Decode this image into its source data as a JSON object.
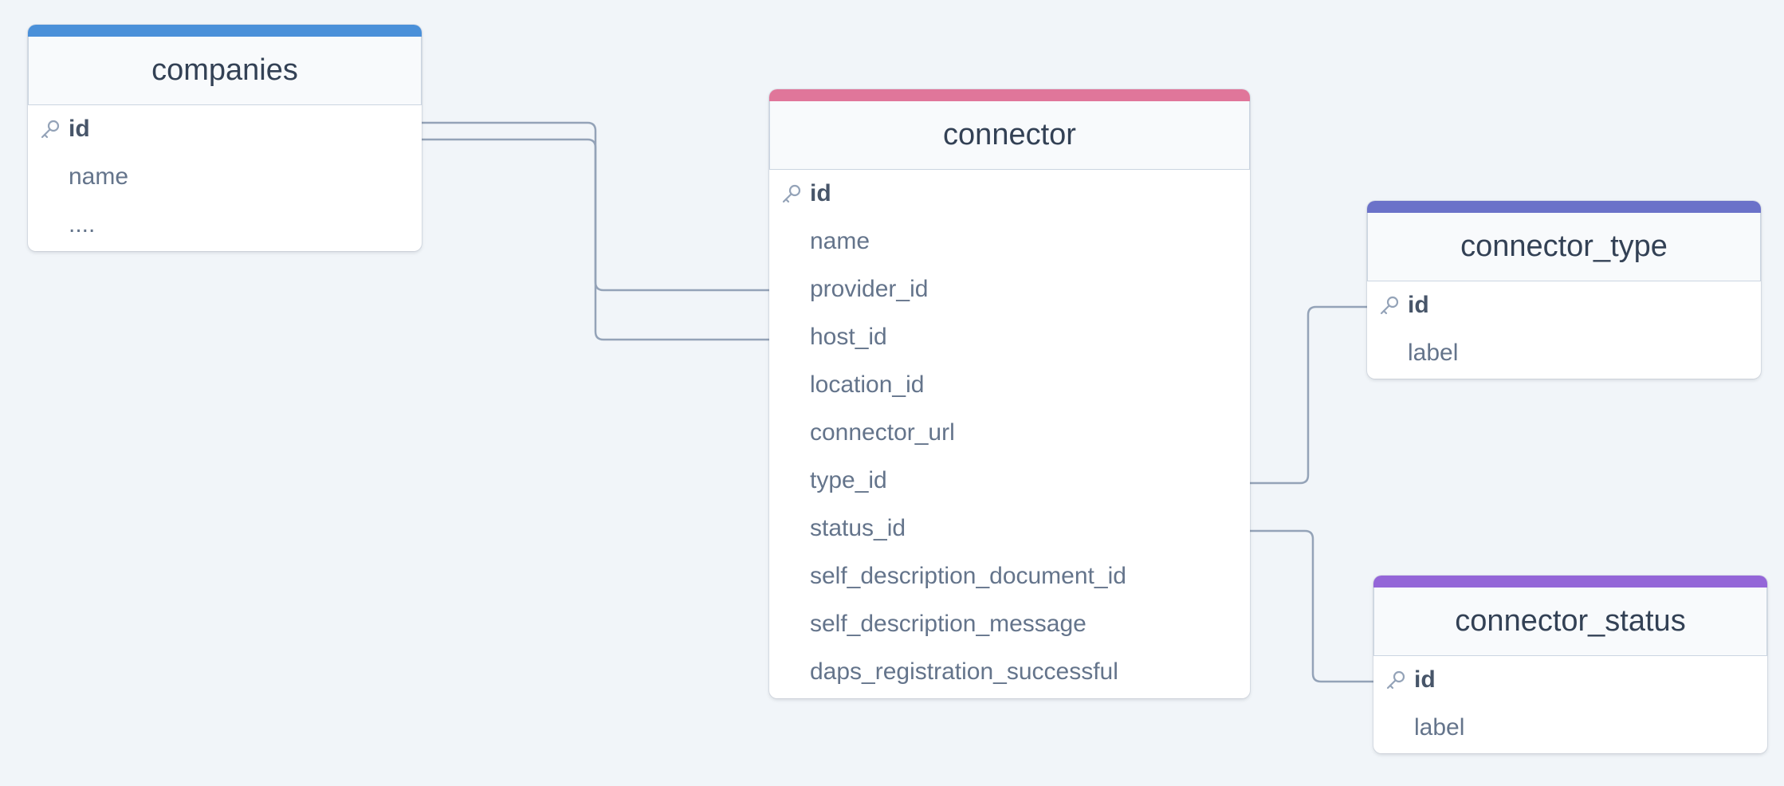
{
  "tables": [
    {
      "id": "companies",
      "name": "companies",
      "accent": "#4a90d9",
      "fields": [
        {
          "label": "id",
          "primary_key": true,
          "icon": "key-icon"
        },
        {
          "label": "name",
          "primary_key": false
        },
        {
          "label": "....",
          "primary_key": false
        }
      ]
    },
    {
      "id": "connector",
      "name": "connector",
      "accent": "#e0769a",
      "fields": [
        {
          "label": "id",
          "primary_key": true,
          "icon": "key-icon"
        },
        {
          "label": "name",
          "primary_key": false
        },
        {
          "label": "provider_id",
          "primary_key": false
        },
        {
          "label": "host_id",
          "primary_key": false
        },
        {
          "label": "location_id",
          "primary_key": false
        },
        {
          "label": "connector_url",
          "primary_key": false
        },
        {
          "label": "type_id",
          "primary_key": false
        },
        {
          "label": "status_id",
          "primary_key": false
        },
        {
          "label": "self_description_document_id",
          "primary_key": false
        },
        {
          "label": "self_description_message",
          "primary_key": false
        },
        {
          "label": "daps_registration_successful",
          "primary_key": false
        }
      ]
    },
    {
      "id": "connector_type",
      "name": "connector_type",
      "accent": "#6b72c9",
      "fields": [
        {
          "label": "id",
          "primary_key": true,
          "icon": "key-icon"
        },
        {
          "label": "label",
          "primary_key": false
        }
      ]
    },
    {
      "id": "connector_status",
      "name": "connector_status",
      "accent": "#9466d8",
      "fields": [
        {
          "label": "id",
          "primary_key": true,
          "icon": "key-icon"
        },
        {
          "label": "label",
          "primary_key": false
        }
      ]
    }
  ],
  "relations": [
    {
      "from": "companies.id",
      "to": "connector.provider_id"
    },
    {
      "from": "companies.id",
      "to": "connector.host_id"
    },
    {
      "from": "connector.type_id",
      "to": "connector_type.id"
    },
    {
      "from": "connector.status_id",
      "to": "connector_status.id"
    }
  ],
  "colors": {
    "background": "#f1f5f9",
    "relation_line": "#94a3b8",
    "header_text": "#334155",
    "field_text": "#64748b"
  }
}
